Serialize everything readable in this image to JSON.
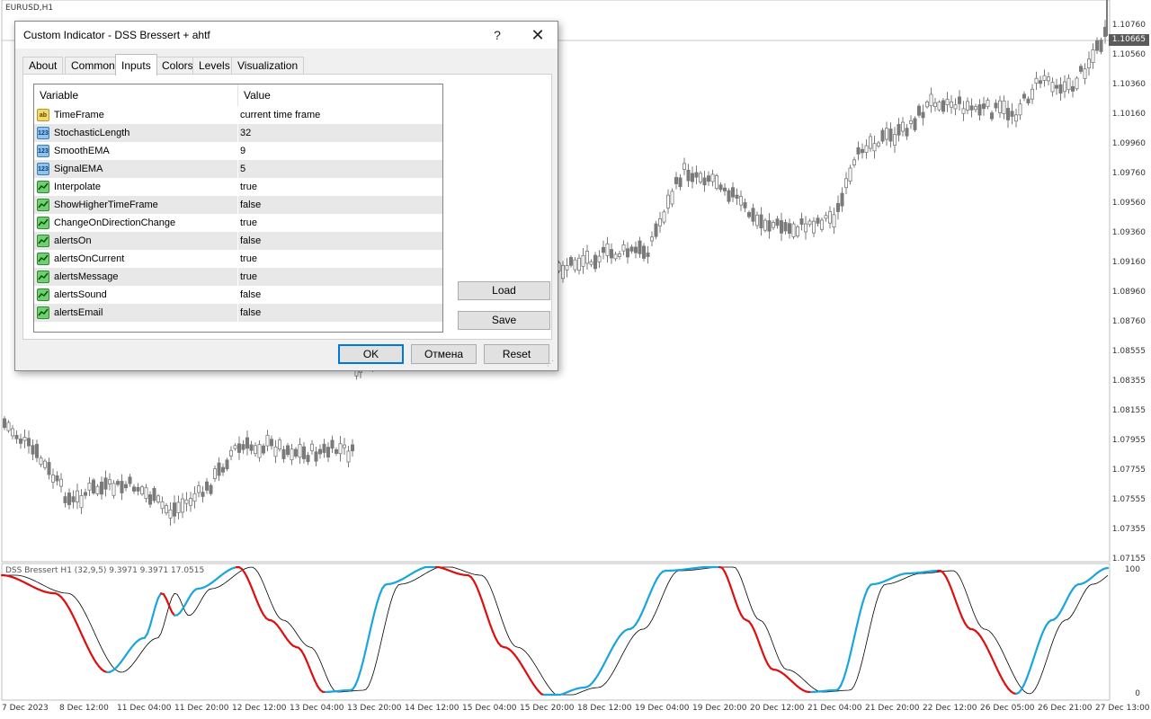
{
  "chart": {
    "symbol": "EURUSD,H1",
    "price_ticks": [
      "1.10760",
      "1.10560",
      "1.10360",
      "1.10160",
      "1.09960",
      "1.09760",
      "1.09560",
      "1.09360",
      "1.09160",
      "1.08960",
      "1.08760",
      "1.08555",
      "1.08355",
      "1.08155",
      "1.07955",
      "1.07755",
      "1.07555",
      "1.07355",
      "1.07155"
    ],
    "current_price": "1.10665",
    "indicator_label": "DSS Bressert H1 (32,9,5) 9.3971 9.3971 17.0515",
    "indicator_ticks": [
      "100",
      "0"
    ],
    "time_ticks": [
      "7 Dec 2023",
      "8 Dec 12:00",
      "11 Dec 04:00",
      "11 Dec 20:00",
      "12 Dec 12:00",
      "13 Dec 04:00",
      "13 Dec 20:00",
      "14 Dec 12:00",
      "15 Dec 04:00",
      "15 Dec 20:00",
      "18 Dec 12:00",
      "19 Dec 04:00",
      "19 Dec 20:00",
      "20 Dec 12:00",
      "21 Dec 04:00",
      "21 Dec 20:00",
      "22 Dec 12:00",
      "26 Dec 05:00",
      "26 Dec 21:00",
      "27 Dec 13:00"
    ],
    "colors": {
      "candle": "#7a7a7a",
      "dss_up": "#1aa6dd",
      "dss_down": "#dd1010",
      "signal": "#000000"
    }
  },
  "dialog": {
    "title": "Custom Indicator - DSS Bressert + ahtf",
    "help_label": "?",
    "close_label": "✕",
    "tabs": [
      {
        "label": "About"
      },
      {
        "label": "Common"
      },
      {
        "label": "Inputs",
        "active": true
      },
      {
        "label": "Colors"
      },
      {
        "label": "Levels"
      },
      {
        "label": "Visualization"
      }
    ],
    "columns": {
      "variable": "Variable",
      "value": "Value"
    },
    "params": [
      {
        "icon": "string-icon",
        "icon_text": "ab",
        "name": "TimeFrame",
        "value": "current time frame"
      },
      {
        "icon": "integer-icon",
        "icon_text": "123",
        "name": "StochasticLength",
        "value": "32"
      },
      {
        "icon": "integer-icon",
        "icon_text": "123",
        "name": "SmoothEMA",
        "value": "9"
      },
      {
        "icon": "integer-icon",
        "icon_text": "123",
        "name": "SignalEMA",
        "value": "5"
      },
      {
        "icon": "boolean-icon",
        "icon_text": "",
        "name": "Interpolate",
        "value": "true"
      },
      {
        "icon": "boolean-icon",
        "icon_text": "",
        "name": "ShowHigherTimeFrame",
        "value": "false"
      },
      {
        "icon": "boolean-icon",
        "icon_text": "",
        "name": "ChangeOnDirectionChange",
        "value": "true"
      },
      {
        "icon": "boolean-icon",
        "icon_text": "",
        "name": "alertsOn",
        "value": "false"
      },
      {
        "icon": "boolean-icon",
        "icon_text": "",
        "name": "alertsOnCurrent",
        "value": "true"
      },
      {
        "icon": "boolean-icon",
        "icon_text": "",
        "name": "alertsMessage",
        "value": "true"
      },
      {
        "icon": "boolean-icon",
        "icon_text": "",
        "name": "alertsSound",
        "value": "false"
      },
      {
        "icon": "boolean-icon",
        "icon_text": "",
        "name": "alertsEmail",
        "value": "false"
      }
    ],
    "load_label": "Load",
    "save_label": "Save",
    "ok_label": "OK",
    "cancel_label": "Отмена",
    "reset_label": "Reset"
  }
}
